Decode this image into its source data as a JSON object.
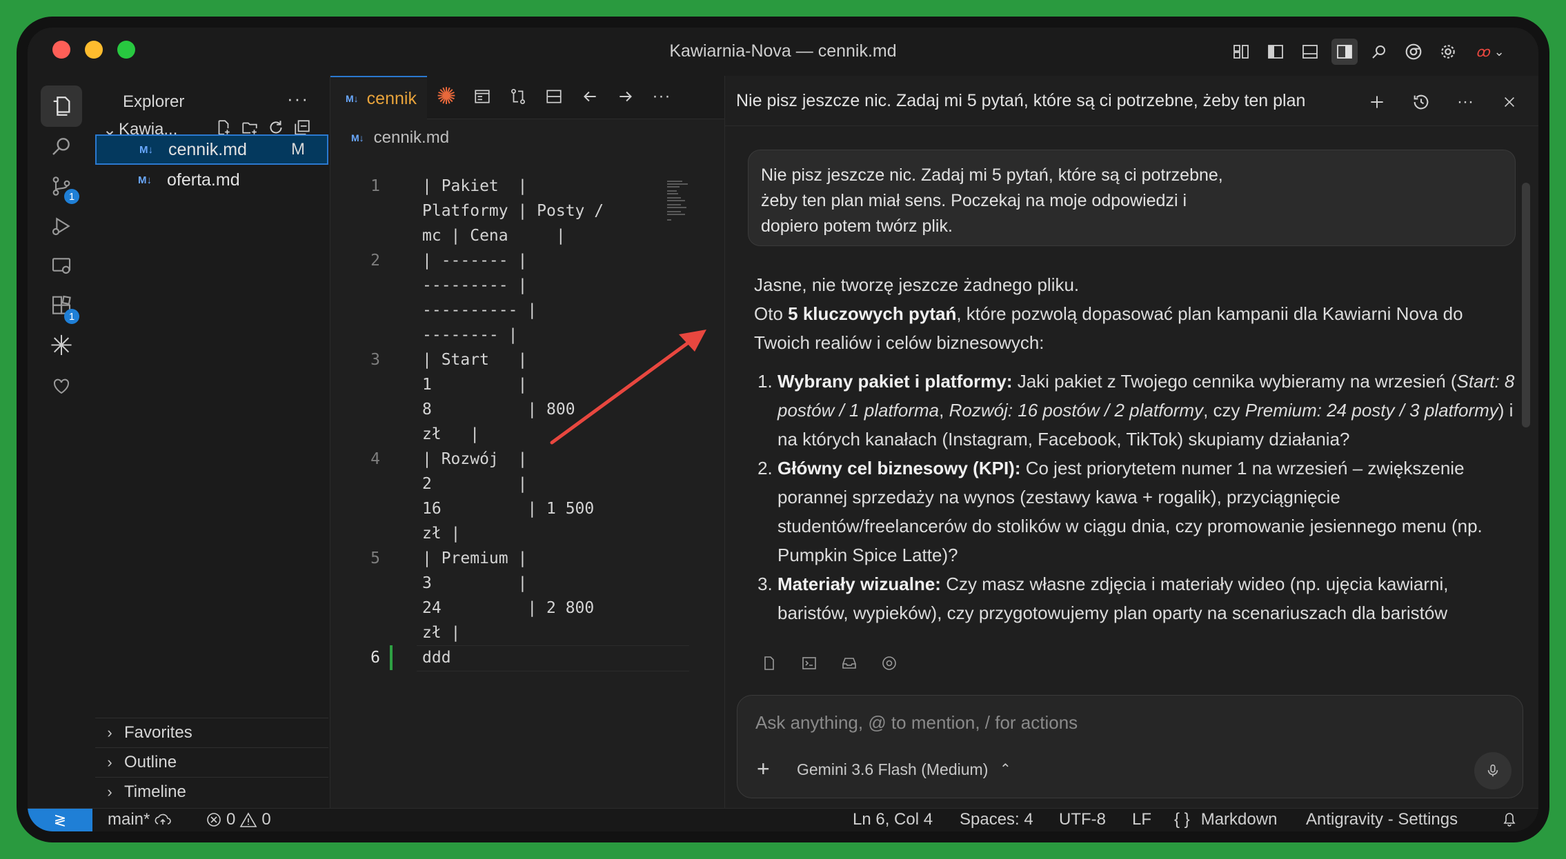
{
  "window": {
    "title": "Kawiarnia-Nova — cennik.md"
  },
  "explorer": {
    "title": "Explorer",
    "more": "···",
    "folder": "Kawia...",
    "files": [
      {
        "name": "cennik.md",
        "status": "M",
        "icon": "M↓"
      },
      {
        "name": "oferta.md",
        "status": "",
        "icon": "M↓"
      }
    ],
    "sections": [
      "Favorites",
      "Outline",
      "Timeline"
    ]
  },
  "activity_badges": {
    "source_control": "1",
    "extensions": "1"
  },
  "editor": {
    "tab_label": "cennik",
    "breadcrumb": "cennik.md",
    "md_icon": "M↓",
    "lines": [
      {
        "n": "1",
        "rows": [
          "| Pakiet  |",
          "Platformy | Posty /",
          "mc | Cena     |"
        ]
      },
      {
        "n": "2",
        "rows": [
          "| ------- |",
          "--------- |",
          "---------- |",
          "-------- |"
        ]
      },
      {
        "n": "3",
        "rows": [
          "| Start   |",
          "1         |",
          "8          | 800",
          "zł   |"
        ]
      },
      {
        "n": "4",
        "rows": [
          "| Rozwój  |",
          "2         |",
          "16         | 1 500",
          "zł |"
        ]
      },
      {
        "n": "5",
        "rows": [
          "| Premium |",
          "3         |",
          "24         | 2 800",
          "zł |"
        ]
      },
      {
        "n": "6",
        "rows": [
          "ddd"
        ]
      }
    ]
  },
  "panel": {
    "title": "Nie pisz jeszcze nic. Zadaj mi 5 pytań, które są ci potrzebne, żeby ten plan",
    "user_message": "Nie pisz jeszcze nic. Zadaj mi 5 pytań, które są ci potrzebne, żeby ten plan miał sens. Poczekaj na moje odpowiedzi i dopiero potem twórz plik.",
    "response": {
      "p1": "Jasne, nie tworzę jeszcze żadnego pliku.",
      "p2_a": "Oto ",
      "p2_bold": "5 kluczowych pytań",
      "p2_b": ", które pozwolą dopasować plan kampanii dla Kawiarni Nova do Twoich realiów i celów biznesowych:",
      "q1_bold": "Wybrany pakiet i platformy:",
      "q1_a": " Jaki pakiet z Twojego cennika wybieramy na wrzesień (",
      "q1_i1": "Start: 8 postów / 1 platforma",
      "q1_sep1": ", ",
      "q1_i2": "Rozwój: 16 postów / 2 platformy",
      "q1_sep2": ", czy ",
      "q1_i3": "Premium: 24 posty / 3 platformy",
      "q1_b": ") i na których kanałach (Instagram, Facebook, TikTok) skupiamy działania?",
      "q2_bold": "Główny cel biznesowy (KPI):",
      "q2_text": " Co jest priorytetem numer 1 na wrzesień – zwiększenie porannej sprzedaży na wynos (zestawy kawa + rogalik), przyciągnięcie studentów/freelancerów do stolików w ciągu dnia, czy promowanie jesiennego menu (np. Pumpkin Spice Latte)?",
      "q3_bold": "Materiały wizualne:",
      "q3_text": " Czy masz własne zdjęcia i materiały wideo (np. ujęcia kawiarni, baristów, wypieków), czy przygotowujemy plan oparty na scenariuszach dla baristów"
    },
    "input_placeholder": "Ask anything, @ to mention, / for actions",
    "model": "Gemini 3.6 Flash (Medium)"
  },
  "statusbar": {
    "branch": "main*",
    "errors": "0",
    "warnings": "0",
    "position": "Ln 6, Col 4",
    "spaces": "Spaces: 4",
    "encoding": "UTF-8",
    "eol": "LF",
    "language": "Markdown",
    "settings": "Antigravity - Settings"
  },
  "colors": {
    "accent": "#1f7fd6",
    "annotation_arrow": "#e8473f",
    "tab_modified": "#e8a33b"
  }
}
